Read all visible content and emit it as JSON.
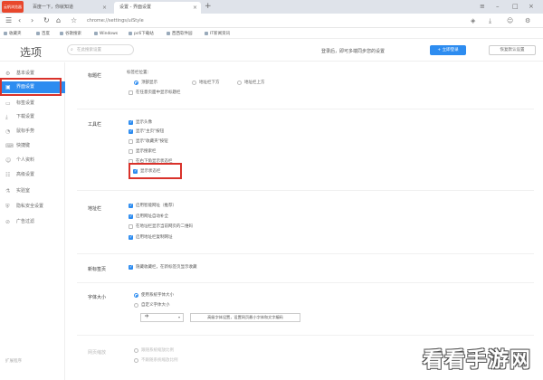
{
  "browser": {
    "logo_text": "云帆浏览器",
    "tabs": [
      {
        "label": "百度一下，你就知道"
      },
      {
        "label": "设置 - 界面设置"
      }
    ],
    "url": "chrome://settings/uiStyle"
  },
  "bookmarks": [
    "收藏夹",
    "百度",
    "谷歌搜索",
    "Windows",
    "pc6下载站",
    "西西软件园",
    "IT新闻资讯"
  ],
  "header": {
    "title": "选项",
    "search_placeholder": "在此搜索设置",
    "hint": "登录后，即可多端同步您的设置",
    "login_button": "+ 立即登录",
    "reset_button": "恢复默认设置"
  },
  "sidebar": {
    "items": [
      {
        "label": "基本设置"
      },
      {
        "label": "界面设置"
      },
      {
        "label": "标签设置"
      },
      {
        "label": "下载设置"
      },
      {
        "label": "鼠标手势"
      },
      {
        "label": "快捷键"
      },
      {
        "label": "个人资料"
      },
      {
        "label": "高级设置"
      },
      {
        "label": "实验室"
      },
      {
        "label": "隐私安全设置"
      },
      {
        "label": "广告过滤"
      }
    ],
    "footer": "扩展程序"
  },
  "sections": {
    "titlebar": {
      "label": "标题栏",
      "sub": "标签栏位置：",
      "radios": [
        "顶部显示",
        "地址栏下方",
        "地址栏上方"
      ],
      "checkbox": "在任意页面中显示标题栏"
    },
    "toolbar": {
      "label": "工具栏",
      "items": [
        "显示头像",
        "显示\"主页\"按钮",
        "显示\"收藏夹\"按钮",
        "显示搜索栏",
        "在右下角显示状态栏",
        "显示状态栏"
      ]
    },
    "addressbar": {
      "label": "地址栏",
      "items": [
        "启用智能网址（推荐）",
        "启用网址自动补全",
        "在地址栏显示当前网页的二维码",
        "启用地址栏复制网址"
      ]
    },
    "newtab": {
      "label": "新标签页",
      "checkbox": "隐藏收藏栏，在新标签页显示收藏"
    },
    "fontsize": {
      "label": "字体大小",
      "radios": [
        "使用系统字体大小",
        "自定义字体大小"
      ],
      "select_value": "中",
      "advanced_button": "高级字体设置，设置网页最小字体和文字编码"
    },
    "zoom": {
      "label": "网页缩放",
      "radios": [
        "跟随系统缩放比例",
        "不跟随系统缩放比例"
      ]
    }
  },
  "watermark": "看看手游网"
}
